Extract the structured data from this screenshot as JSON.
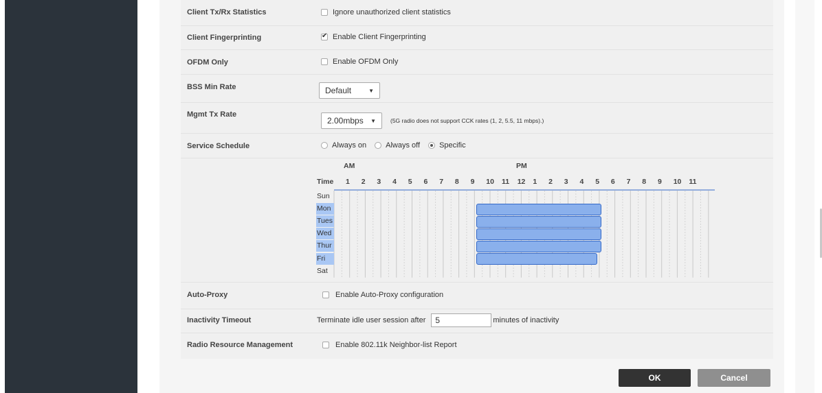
{
  "rows": {
    "client_stats": {
      "label": "Client Tx/Rx Statistics",
      "option": "Ignore unauthorized client statistics",
      "checked": false
    },
    "fingerprinting": {
      "label": "Client Fingerprinting",
      "option": "Enable Client Fingerprinting",
      "checked": true
    },
    "ofdm": {
      "label": "OFDM Only",
      "option": "Enable OFDM Only",
      "checked": false
    },
    "bss_min_rate": {
      "label": "BSS Min Rate",
      "value": "Default"
    },
    "mgmt_tx_rate": {
      "label": "Mgmt Tx Rate",
      "value": "2.00mbps",
      "note": "(5G radio does not support CCK rates (1, 2, 5.5, 11 mbps).)"
    },
    "service_schedule": {
      "label": "Service Schedule",
      "options": [
        "Always on",
        "Always off",
        "Specific"
      ],
      "selected": "Specific"
    },
    "auto_proxy": {
      "label": "Auto-Proxy",
      "option": "Enable Auto-Proxy configuration",
      "checked": false
    },
    "inactivity": {
      "label": "Inactivity Timeout",
      "prefix": "Terminate idle user session after",
      "value": "5",
      "suffix": "minutes of inactivity"
    },
    "rrm": {
      "label": "Radio Resource Management",
      "option": "Enable 802.11k Neighbor-list Report",
      "checked": false
    }
  },
  "schedule": {
    "am_label": "AM",
    "pm_label": "PM",
    "time_label": "Time",
    "hour_labels": [
      "1",
      "2",
      "3",
      "4",
      "5",
      "6",
      "7",
      "8",
      "9",
      "10",
      "11",
      "12",
      "1",
      "2",
      "3",
      "4",
      "5",
      "6",
      "7",
      "8",
      "9",
      "10",
      "11"
    ],
    "days": [
      "Sun",
      "Mon",
      "Tues",
      "Wed",
      "Thur",
      "Fri",
      "Sat"
    ],
    "selected_days": [
      "Mon",
      "Tues",
      "Wed",
      "Thur",
      "Fri"
    ],
    "ranges": [
      {
        "day": "Mon",
        "start": 9,
        "end": 17
      },
      {
        "day": "Tues",
        "start": 9,
        "end": 17
      },
      {
        "day": "Wed",
        "start": 9,
        "end": 17
      },
      {
        "day": "Thur",
        "start": 9,
        "end": 17
      },
      {
        "day": "Fri",
        "start": 9,
        "end": 16.75
      }
    ]
  },
  "buttons": {
    "ok": "OK",
    "cancel": "Cancel"
  },
  "colors": {
    "sidebar": "#2b333b",
    "selection": "#8ab0ec",
    "selection_border": "#3368c8",
    "ok": "#333333",
    "cancel": "#8f8f8f"
  }
}
